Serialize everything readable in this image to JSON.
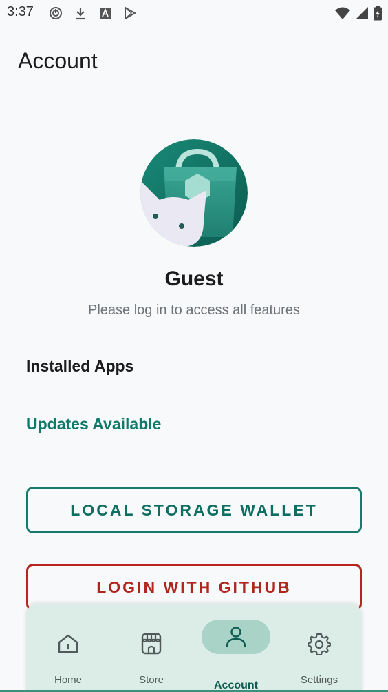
{
  "status_bar": {
    "time": "3:37",
    "icons_left": [
      "music-icon",
      "download-icon",
      "font-icon",
      "play-store-icon"
    ],
    "icons_right": [
      "wifi-icon",
      "signal-icon",
      "battery-icon"
    ]
  },
  "page": {
    "title": "Account"
  },
  "profile": {
    "name": "Guest",
    "subtitle": "Please log in to access all features",
    "avatar_icon": "cat-shopping-bag-avatar"
  },
  "sections": {
    "installed_apps": "Installed Apps",
    "updates_available": "Updates Available"
  },
  "buttons": {
    "wallet": "LOCAL STORAGE WALLET",
    "github": "LOGIN WITH GITHUB"
  },
  "bottom_nav": {
    "items": [
      {
        "label": "Home",
        "icon": "home-icon"
      },
      {
        "label": "Store",
        "icon": "store-icon"
      },
      {
        "label": "Account",
        "icon": "person-icon",
        "active": true
      },
      {
        "label": "Settings",
        "icon": "gear-icon"
      }
    ]
  },
  "colors": {
    "accent": "#0f7a6a",
    "wallet_border": "#177a6c",
    "github": "#b0251d",
    "nav_background": "#dcece6",
    "nav_active_pill": "#a9d3c7",
    "page_background": "#f8f9fb"
  }
}
